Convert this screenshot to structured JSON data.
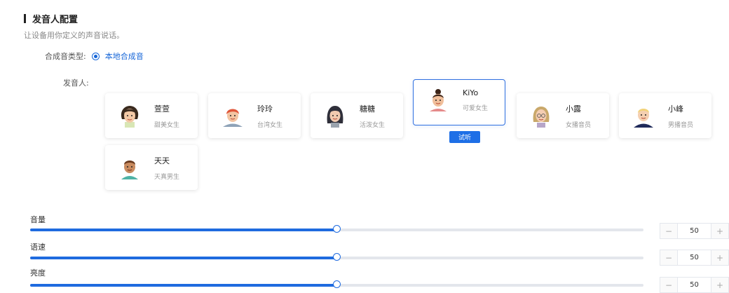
{
  "section": {
    "title": "发音人配置",
    "description": "让设备用你定义的声音说话。"
  },
  "synth_type": {
    "label": "合成音类型:",
    "option": "本地合成音",
    "selected": true
  },
  "speaker_label": "发音人:",
  "speakers": [
    {
      "name": "萱萱",
      "desc": "甜美女生",
      "icon": "girl-curly-avatar-icon",
      "selected": false
    },
    {
      "name": "玲玲",
      "desc": "台湾女生",
      "icon": "girl-redhair-avatar-icon",
      "selected": false
    },
    {
      "name": "糖糖",
      "desc": "活泼女生",
      "icon": "girl-darkhair-avatar-icon",
      "selected": false
    },
    {
      "name": "KiYo",
      "desc": "可爱女生",
      "icon": "girl-bun-avatar-icon",
      "selected": true
    },
    {
      "name": "小露",
      "desc": "女播音员",
      "icon": "woman-glasses-avatar-icon",
      "selected": false
    },
    {
      "name": "小峰",
      "desc": "男播音员",
      "icon": "man-blonde-avatar-icon",
      "selected": false
    },
    {
      "name": "天天",
      "desc": "天真男生",
      "icon": "boy-brown-avatar-icon",
      "selected": false
    }
  ],
  "try_button": "试听",
  "sliders": [
    {
      "label": "音量",
      "value": "50",
      "fraction": 0.5
    },
    {
      "label": "语速",
      "value": "50",
      "fraction": 0.5
    },
    {
      "label": "亮度",
      "value": "50",
      "fraction": 0.5
    }
  ],
  "stepper_minus": "−",
  "stepper_plus": "+",
  "colors": {
    "accent": "#1f6bdf",
    "track": "#e3e6ec"
  }
}
